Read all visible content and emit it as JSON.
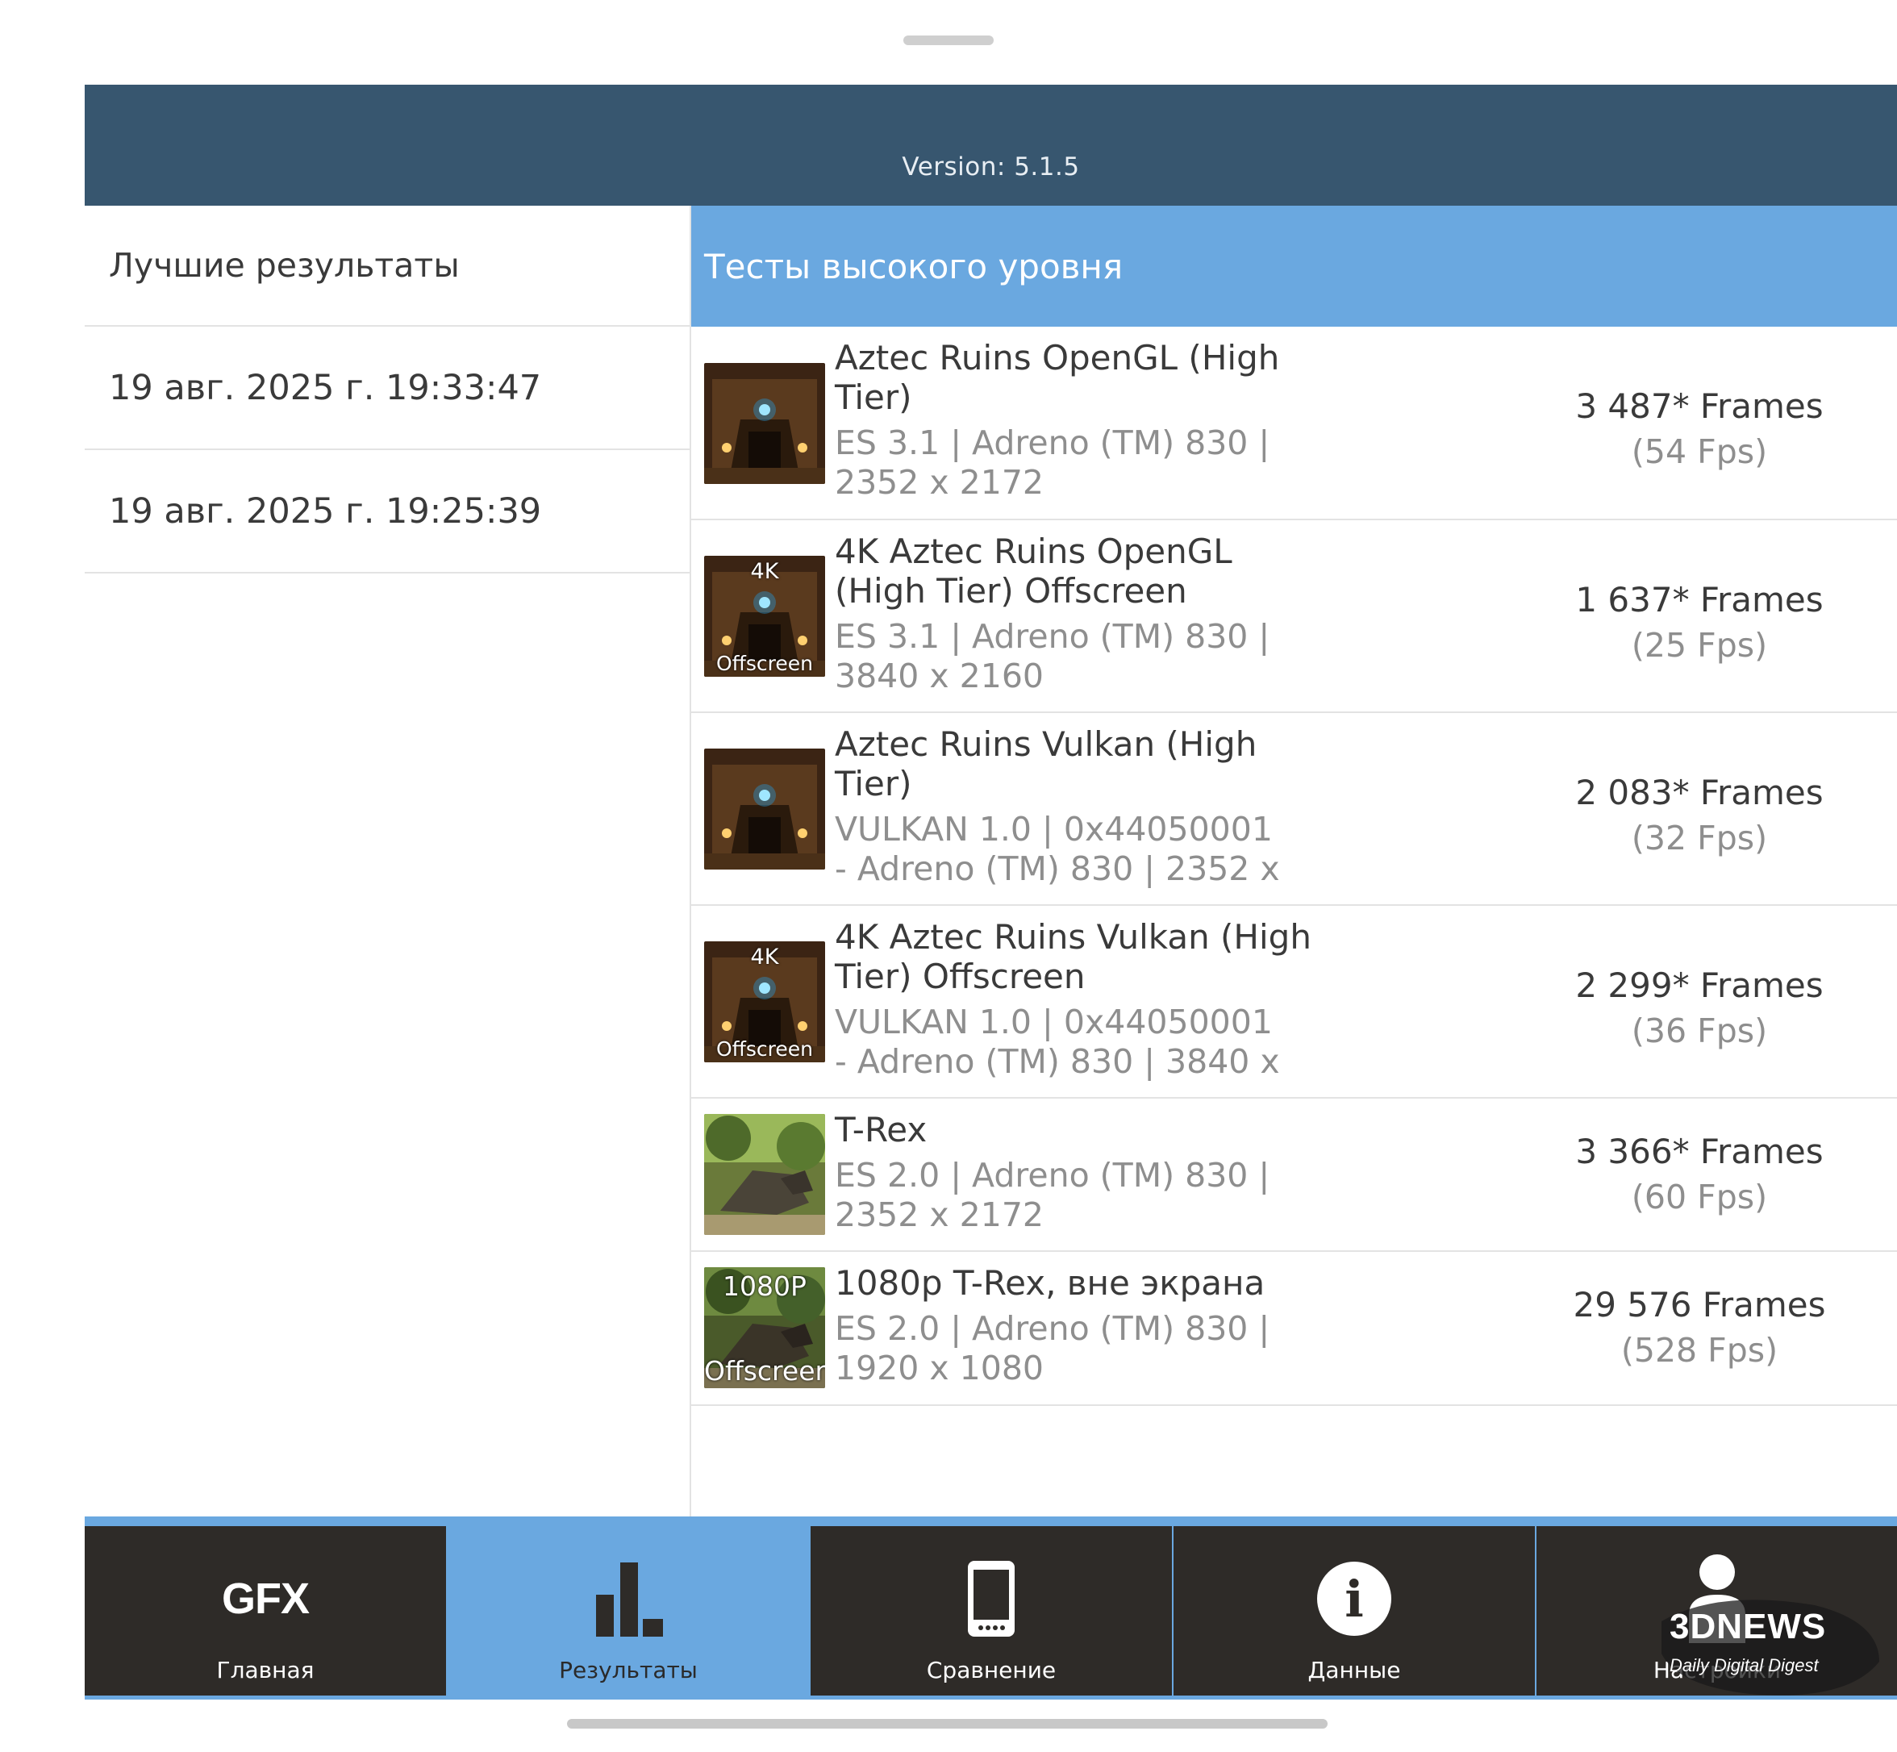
{
  "header": {
    "version": "Version: 5.1.5"
  },
  "left_panel": {
    "title": "Лучшие результаты",
    "items": [
      {
        "label": "19 авг. 2025 г. 19:33:47"
      },
      {
        "label": "19 авг. 2025 г. 19:25:39"
      }
    ]
  },
  "right_panel": {
    "title": "Тесты высокого уровня",
    "tests": [
      {
        "name_line1": "Aztec Ruins OpenGL (High",
        "name_line2": "Tier)",
        "detail_line1": "ES 3.1 | Adreno (TM) 830 |",
        "detail_line2": "2352 x 2172",
        "frames": "3 487* Frames",
        "fps": "(54 Fps)",
        "thumb": "aztec",
        "badge_top": "",
        "badge_bottom": ""
      },
      {
        "name_line1": "4K Aztec Ruins OpenGL",
        "name_line2": "(High Tier) Offscreen",
        "detail_line1": "ES 3.1 | Adreno (TM) 830 |",
        "detail_line2": "3840 x 2160",
        "frames": "1 637* Frames",
        "fps": "(25 Fps)",
        "thumb": "aztec",
        "badge_top": "4K",
        "badge_bottom": "Offscreen"
      },
      {
        "name_line1": "Aztec Ruins Vulkan (High",
        "name_line2": "Tier)",
        "detail_line1": "VULKAN 1.0 | 0x44050001",
        "detail_line2": "- Adreno (TM) 830 | 2352 x",
        "frames": "2 083* Frames",
        "fps": "(32 Fps)",
        "thumb": "aztec",
        "badge_top": "",
        "badge_bottom": ""
      },
      {
        "name_line1": "4K Aztec Ruins Vulkan (High",
        "name_line2": "Tier) Offscreen",
        "detail_line1": "VULKAN 1.0 | 0x44050001",
        "detail_line2": "- Adreno (TM) 830 | 3840 x",
        "frames": "2 299* Frames",
        "fps": "(36 Fps)",
        "thumb": "aztec",
        "badge_top": "4K",
        "badge_bottom": "Offscreen"
      },
      {
        "name_line1": "T-Rex",
        "name_line2": "",
        "detail_line1": "ES 2.0 | Adreno (TM) 830 |",
        "detail_line2": "2352 x 2172",
        "frames": "3 366* Frames",
        "fps": "(60 Fps)",
        "thumb": "trex",
        "badge_top": "",
        "badge_bottom": ""
      },
      {
        "name_line1": "1080p T-Rex, вне экрана",
        "name_line2": "",
        "detail_line1": "ES 2.0 | Adreno (TM) 830 |",
        "detail_line2": "1920 x 1080",
        "frames": "29 576 Frames",
        "fps": "(528 Fps)",
        "thumb": "trex",
        "badge_top": "1080P",
        "badge_bottom": "Offscreen"
      }
    ]
  },
  "nav": {
    "items": [
      {
        "label": "Главная",
        "icon": "gfx-logo-icon",
        "icon_text": "GFX"
      },
      {
        "label": "Результаты",
        "icon": "bar-chart-icon"
      },
      {
        "label": "Сравнение",
        "icon": "phone-icon"
      },
      {
        "label": "Данные",
        "icon": "info-icon",
        "icon_text": "i"
      },
      {
        "label": "Настройки",
        "icon": "user-icon"
      }
    ]
  },
  "watermark": {
    "brand": "3DNEWS",
    "tagline": "Daily Digital Digest"
  },
  "colors": {
    "header_bg": "#37566f",
    "accent_blue": "#6aa8e0",
    "nav_dark": "#2e2b28"
  }
}
